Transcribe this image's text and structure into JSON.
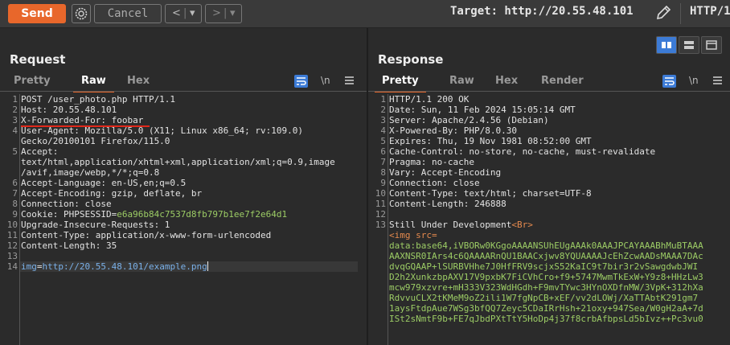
{
  "toolbar": {
    "send_label": "Send",
    "cancel_label": "Cancel",
    "back_glyph": "<",
    "forward_glyph": ">",
    "dropdown_glyph": "▾",
    "target_label": "Target: http://20.55.48.101",
    "protocol_label": "HTTP/1",
    "accent_color": "#e8672b"
  },
  "request": {
    "title": "Request",
    "tabs": [
      "Pretty",
      "Raw",
      "Hex"
    ],
    "active_tab": "Raw",
    "newline_label": "\\n",
    "lines": [
      {
        "n": "1",
        "text": "POST /user_photo.php HTTP/1.1"
      },
      {
        "n": "2",
        "text": "Host: 20.55.48.101"
      },
      {
        "n": "3",
        "text": "X-Forwarded-For: foobar"
      },
      {
        "n": "4",
        "text": "User-Agent: Mozilla/5.0 (X11; Linux x86_64; rv:109.0)"
      },
      {
        "n": "",
        "text": "Gecko/20100101 Firefox/115.0"
      },
      {
        "n": "5",
        "text": "Accept:"
      },
      {
        "n": "",
        "text": "text/html,application/xhtml+xml,application/xml;q=0.9,image"
      },
      {
        "n": "",
        "text": "/avif,image/webp,*/*;q=0.8"
      },
      {
        "n": "6",
        "text": "Accept-Language: en-US,en;q=0.5"
      },
      {
        "n": "7",
        "text": "Accept-Encoding: gzip, deflate, br"
      },
      {
        "n": "8",
        "text": "Connection: close"
      },
      {
        "n": "9",
        "text_key": "Cookie: PHPSESSID=",
        "text_val": "e6a96b84c7537d8fb797b1ee7f2e64d1"
      },
      {
        "n": "10",
        "text": "Upgrade-Insecure-Requests: 1"
      },
      {
        "n": "11",
        "text": "Content-Type: application/x-www-form-urlencoded"
      },
      {
        "n": "12",
        "text": "Content-Length: 35"
      },
      {
        "n": "13",
        "text": ""
      },
      {
        "n": "14",
        "text_key": "img",
        "text_eq": "=",
        "text_val": "http://20.55.48.101/example.png"
      }
    ]
  },
  "response": {
    "title": "Response",
    "tabs": [
      "Pretty",
      "Raw",
      "Hex",
      "Render"
    ],
    "active_tab": "Pretty",
    "newline_label": "\\n",
    "lines": [
      {
        "n": "1",
        "text": "HTTP/1.1 200 OK"
      },
      {
        "n": "2",
        "text": "Date: Sun, 11 Feb 2024 15:05:14 GMT"
      },
      {
        "n": "3",
        "text": "Server: Apache/2.4.56 (Debian)"
      },
      {
        "n": "4",
        "text": "X-Powered-By: PHP/8.0.30"
      },
      {
        "n": "5",
        "text": "Expires: Thu, 19 Nov 1981 08:52:00 GMT"
      },
      {
        "n": "6",
        "text": "Cache-Control: no-store, no-cache, must-revalidate"
      },
      {
        "n": "7",
        "text": "Pragma: no-cache"
      },
      {
        "n": "8",
        "text": "Vary: Accept-Encoding"
      },
      {
        "n": "9",
        "text": "Connection: close"
      },
      {
        "n": "10",
        "text": "Content-Type: text/html; charset=UTF-8"
      },
      {
        "n": "11",
        "text": "Content-Length: 246888"
      },
      {
        "n": "12",
        "text": ""
      },
      {
        "n": "13",
        "text_pre": "Still Under Development",
        "text_tag": "<Br>"
      },
      {
        "n": "",
        "text_pre": "<img src=",
        "text_tag": ""
      },
      {
        "n": "",
        "text_green": "data:base64,iVBORw0KGgoAAAANSUhEUgAAAk0AAAJPCAYAAABhMuBTAAA"
      },
      {
        "n": "",
        "text_green": "AAXNSR0IArs4c6QAAAARnQU1BAACxjwv8YQUAAAAJcEhZcwAADsMAAA7DAc"
      },
      {
        "n": "",
        "text_green": "dvqGQAAP+lSURBVHhe7J0HfFRV9scjxS52KaIC9t7bir3r2vSawgdwbJWI"
      },
      {
        "n": "",
        "text_green": "D2h2XunkzbpAXV17V9pxbK7FiCVhCro+f9+5747MwmTkExW+Y9z8+HHzLw3"
      },
      {
        "n": "",
        "text_green": "mcw979xzvre+mH333V323WdHGdh+F9mvTYwc3HYnOXDfnMW/3VpK+312hXa"
      },
      {
        "n": "",
        "text_green": "RdvvuCLX2tKMeM9oZ2ili1W7fgNpCB+xEF/vv2dLOWj/XaTTAbtK291gm7"
      },
      {
        "n": "",
        "text_green": "1aysFtdpAue7WSg3bfQQ7Zeyc5CDaIRrHsh+21oxy+947Sea/W0gH2aA+7d"
      },
      {
        "n": "",
        "text_green": "ISt2sNmtF9b+FE7qJbdPXtTtY5HoDp4j37f8crbAfbpsLd5bIvz++Pc3vu0"
      }
    ]
  }
}
